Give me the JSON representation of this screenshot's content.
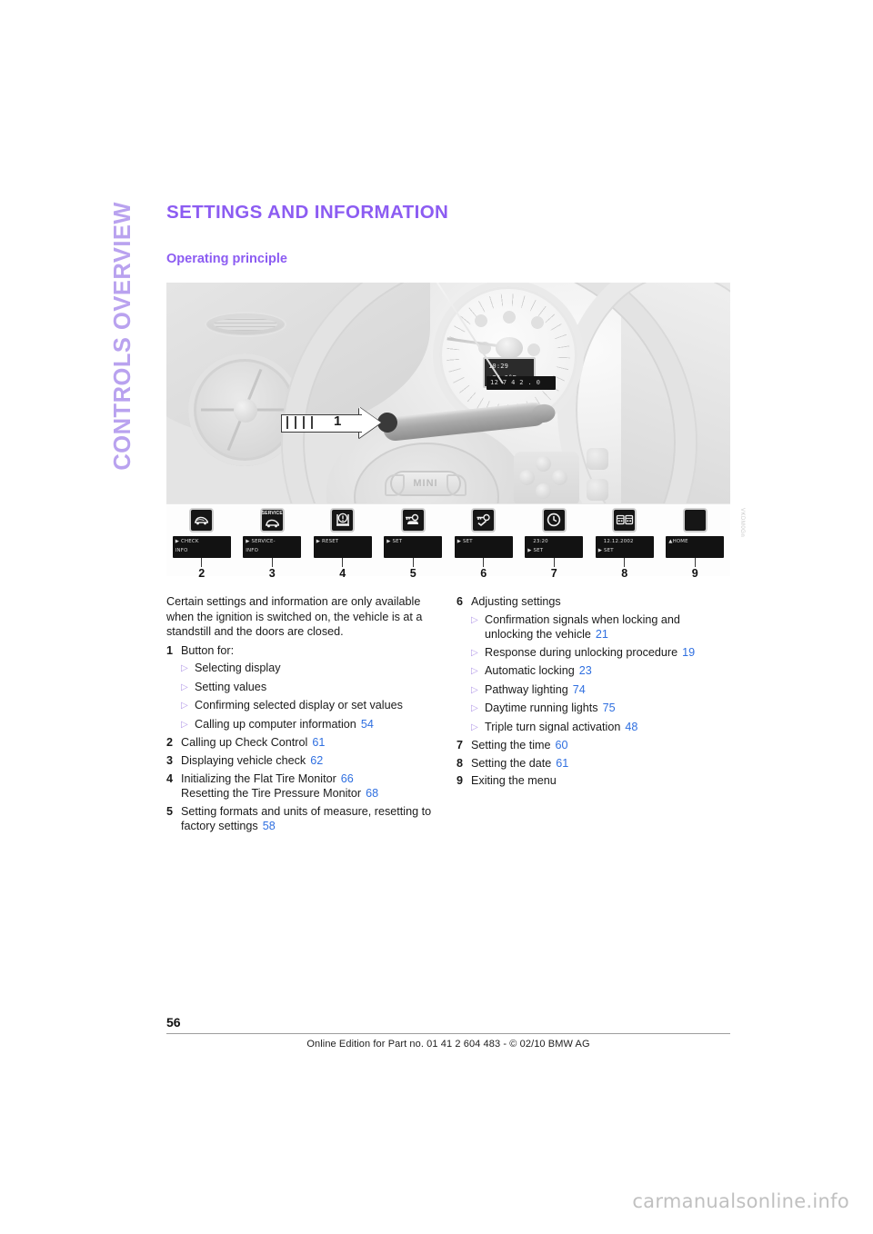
{
  "chapter_tab": {
    "label": "CONTROLS OVERVIEW"
  },
  "page": {
    "title": "SETTINGS AND INFORMATION",
    "section_title": "Operating principle",
    "page_number": "56",
    "imprint": "Online Edition for Part no. 01 41 2 604 483 - © 02/10  BMW AG",
    "watermark": "carmanualsonline.info",
    "figure_code": "VKDM0Gn"
  },
  "colors": {
    "heading_purple": "#8c5cf2",
    "tab_purple": "#b9a2ef",
    "page_ref_blue": "#2f6fe0",
    "bullet_triangle": "#b39ae8"
  },
  "figure": {
    "callout_label": "1",
    "cluster_display": {
      "line1": "10:29",
      "line2": "+74.0°F"
    },
    "odometer_display": "12 7 4 2 . 0",
    "wheel_badge": "MINI",
    "icons": [
      {
        "number": "2",
        "icon": "car-hood-open-icon",
        "lcd_line1": "CHECK",
        "lcd_line2": "INFO",
        "has_cursor": true
      },
      {
        "number": "3",
        "icon": "car-service-icon",
        "icon_word": "SERVICE",
        "lcd_line1": "SERVICE-",
        "lcd_line2": "INFO",
        "has_cursor": true
      },
      {
        "number": "4",
        "icon": "tire-pressure-warning-icon",
        "lcd_line1": "RESET",
        "lcd_line2": "",
        "has_cursor": true
      },
      {
        "number": "5",
        "icon": "key-with-car-icon",
        "lcd_line1": "SET",
        "lcd_line2": "",
        "has_cursor": true
      },
      {
        "number": "6",
        "icon": "key-with-check-icon",
        "lcd_line1": "SET",
        "lcd_line2": "",
        "has_cursor": true
      },
      {
        "number": "7",
        "icon": "clock-icon",
        "lcd_line1": "23:20",
        "lcd_line2": "SET",
        "has_cursor": true
      },
      {
        "number": "8",
        "icon": "calendar-icon",
        "lcd_line1": "12.12.2002",
        "lcd_line2": "SET",
        "has_cursor": true
      },
      {
        "number": "9",
        "icon": "blank-icon",
        "lcd_line1": "HOME",
        "lcd_line2": "",
        "has_cursor": true
      }
    ]
  },
  "body": {
    "lead": "Certain settings and information are only available when the ignition is switched on, the vehicle is at a standstill and the doors are closed.",
    "left_items": [
      {
        "num": "1",
        "text": "Button for:",
        "page": "",
        "bullets": [
          {
            "text": "Selecting display",
            "page": ""
          },
          {
            "text": "Setting values",
            "page": ""
          },
          {
            "text": "Confirming selected display or set values",
            "page": ""
          },
          {
            "text": "Calling up computer information",
            "page": "54"
          }
        ]
      },
      {
        "num": "2",
        "text": "Calling up Check Control",
        "page": "61",
        "bullets": []
      },
      {
        "num": "3",
        "text": "Displaying vehicle check",
        "page": "62",
        "bullets": []
      },
      {
        "num": "4",
        "text": "Initializing the Flat Tire Monitor",
        "page": "66",
        "second_line": "Resetting the Tire Pressure Monitor",
        "second_page": "68",
        "bullets": []
      },
      {
        "num": "5",
        "text": "Setting formats and units of measure, resetting to factory settings",
        "page": "58",
        "bullets": []
      }
    ],
    "right_items": [
      {
        "num": "6",
        "text": "Adjusting settings",
        "page": "",
        "bullets": [
          {
            "text": "Confirmation signals when locking and unlocking the vehicle",
            "page": "21"
          },
          {
            "text": "Response during unlocking procedure",
            "page": "19"
          },
          {
            "text": "Automatic locking",
            "page": "23"
          },
          {
            "text": "Pathway lighting",
            "page": "74"
          },
          {
            "text": "Daytime running lights",
            "page": "75"
          },
          {
            "text": "Triple turn signal activation",
            "page": "48"
          }
        ]
      },
      {
        "num": "7",
        "text": "Setting the time",
        "page": "60",
        "bullets": []
      },
      {
        "num": "8",
        "text": "Setting the date",
        "page": "61",
        "bullets": []
      },
      {
        "num": "9",
        "text": "Exiting the menu",
        "page": "",
        "bullets": []
      }
    ]
  }
}
